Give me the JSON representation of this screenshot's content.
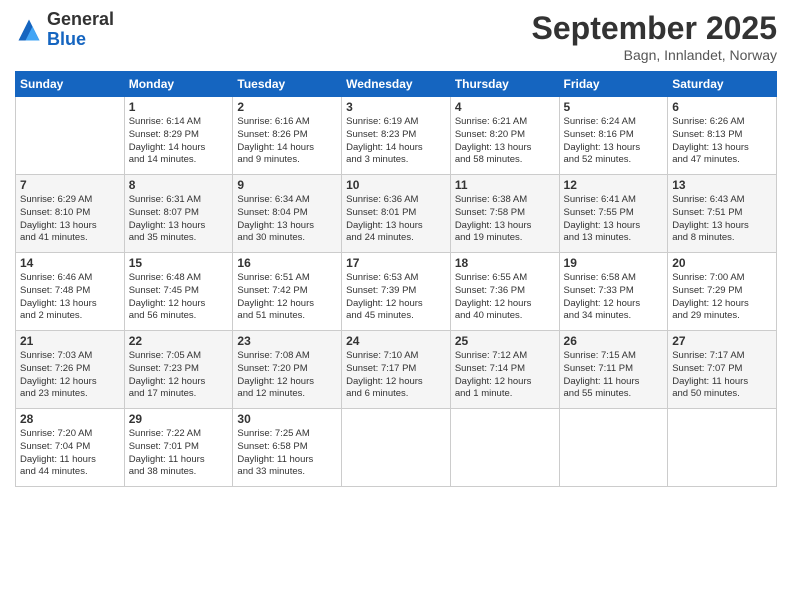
{
  "header": {
    "logo_general": "General",
    "logo_blue": "Blue",
    "month_title": "September 2025",
    "location": "Bagn, Innlandet, Norway"
  },
  "days_of_week": [
    "Sunday",
    "Monday",
    "Tuesday",
    "Wednesday",
    "Thursday",
    "Friday",
    "Saturday"
  ],
  "weeks": [
    [
      {
        "day": "",
        "info": ""
      },
      {
        "day": "1",
        "info": "Sunrise: 6:14 AM\nSunset: 8:29 PM\nDaylight: 14 hours\nand 14 minutes."
      },
      {
        "day": "2",
        "info": "Sunrise: 6:16 AM\nSunset: 8:26 PM\nDaylight: 14 hours\nand 9 minutes."
      },
      {
        "day": "3",
        "info": "Sunrise: 6:19 AM\nSunset: 8:23 PM\nDaylight: 14 hours\nand 3 minutes."
      },
      {
        "day": "4",
        "info": "Sunrise: 6:21 AM\nSunset: 8:20 PM\nDaylight: 13 hours\nand 58 minutes."
      },
      {
        "day": "5",
        "info": "Sunrise: 6:24 AM\nSunset: 8:16 PM\nDaylight: 13 hours\nand 52 minutes."
      },
      {
        "day": "6",
        "info": "Sunrise: 6:26 AM\nSunset: 8:13 PM\nDaylight: 13 hours\nand 47 minutes."
      }
    ],
    [
      {
        "day": "7",
        "info": "Sunrise: 6:29 AM\nSunset: 8:10 PM\nDaylight: 13 hours\nand 41 minutes."
      },
      {
        "day": "8",
        "info": "Sunrise: 6:31 AM\nSunset: 8:07 PM\nDaylight: 13 hours\nand 35 minutes."
      },
      {
        "day": "9",
        "info": "Sunrise: 6:34 AM\nSunset: 8:04 PM\nDaylight: 13 hours\nand 30 minutes."
      },
      {
        "day": "10",
        "info": "Sunrise: 6:36 AM\nSunset: 8:01 PM\nDaylight: 13 hours\nand 24 minutes."
      },
      {
        "day": "11",
        "info": "Sunrise: 6:38 AM\nSunset: 7:58 PM\nDaylight: 13 hours\nand 19 minutes."
      },
      {
        "day": "12",
        "info": "Sunrise: 6:41 AM\nSunset: 7:55 PM\nDaylight: 13 hours\nand 13 minutes."
      },
      {
        "day": "13",
        "info": "Sunrise: 6:43 AM\nSunset: 7:51 PM\nDaylight: 13 hours\nand 8 minutes."
      }
    ],
    [
      {
        "day": "14",
        "info": "Sunrise: 6:46 AM\nSunset: 7:48 PM\nDaylight: 13 hours\nand 2 minutes."
      },
      {
        "day": "15",
        "info": "Sunrise: 6:48 AM\nSunset: 7:45 PM\nDaylight: 12 hours\nand 56 minutes."
      },
      {
        "day": "16",
        "info": "Sunrise: 6:51 AM\nSunset: 7:42 PM\nDaylight: 12 hours\nand 51 minutes."
      },
      {
        "day": "17",
        "info": "Sunrise: 6:53 AM\nSunset: 7:39 PM\nDaylight: 12 hours\nand 45 minutes."
      },
      {
        "day": "18",
        "info": "Sunrise: 6:55 AM\nSunset: 7:36 PM\nDaylight: 12 hours\nand 40 minutes."
      },
      {
        "day": "19",
        "info": "Sunrise: 6:58 AM\nSunset: 7:33 PM\nDaylight: 12 hours\nand 34 minutes."
      },
      {
        "day": "20",
        "info": "Sunrise: 7:00 AM\nSunset: 7:29 PM\nDaylight: 12 hours\nand 29 minutes."
      }
    ],
    [
      {
        "day": "21",
        "info": "Sunrise: 7:03 AM\nSunset: 7:26 PM\nDaylight: 12 hours\nand 23 minutes."
      },
      {
        "day": "22",
        "info": "Sunrise: 7:05 AM\nSunset: 7:23 PM\nDaylight: 12 hours\nand 17 minutes."
      },
      {
        "day": "23",
        "info": "Sunrise: 7:08 AM\nSunset: 7:20 PM\nDaylight: 12 hours\nand 12 minutes."
      },
      {
        "day": "24",
        "info": "Sunrise: 7:10 AM\nSunset: 7:17 PM\nDaylight: 12 hours\nand 6 minutes."
      },
      {
        "day": "25",
        "info": "Sunrise: 7:12 AM\nSunset: 7:14 PM\nDaylight: 12 hours\nand 1 minute."
      },
      {
        "day": "26",
        "info": "Sunrise: 7:15 AM\nSunset: 7:11 PM\nDaylight: 11 hours\nand 55 minutes."
      },
      {
        "day": "27",
        "info": "Sunrise: 7:17 AM\nSunset: 7:07 PM\nDaylight: 11 hours\nand 50 minutes."
      }
    ],
    [
      {
        "day": "28",
        "info": "Sunrise: 7:20 AM\nSunset: 7:04 PM\nDaylight: 11 hours\nand 44 minutes."
      },
      {
        "day": "29",
        "info": "Sunrise: 7:22 AM\nSunset: 7:01 PM\nDaylight: 11 hours\nand 38 minutes."
      },
      {
        "day": "30",
        "info": "Sunrise: 7:25 AM\nSunset: 6:58 PM\nDaylight: 11 hours\nand 33 minutes."
      },
      {
        "day": "",
        "info": ""
      },
      {
        "day": "",
        "info": ""
      },
      {
        "day": "",
        "info": ""
      },
      {
        "day": "",
        "info": ""
      }
    ]
  ]
}
